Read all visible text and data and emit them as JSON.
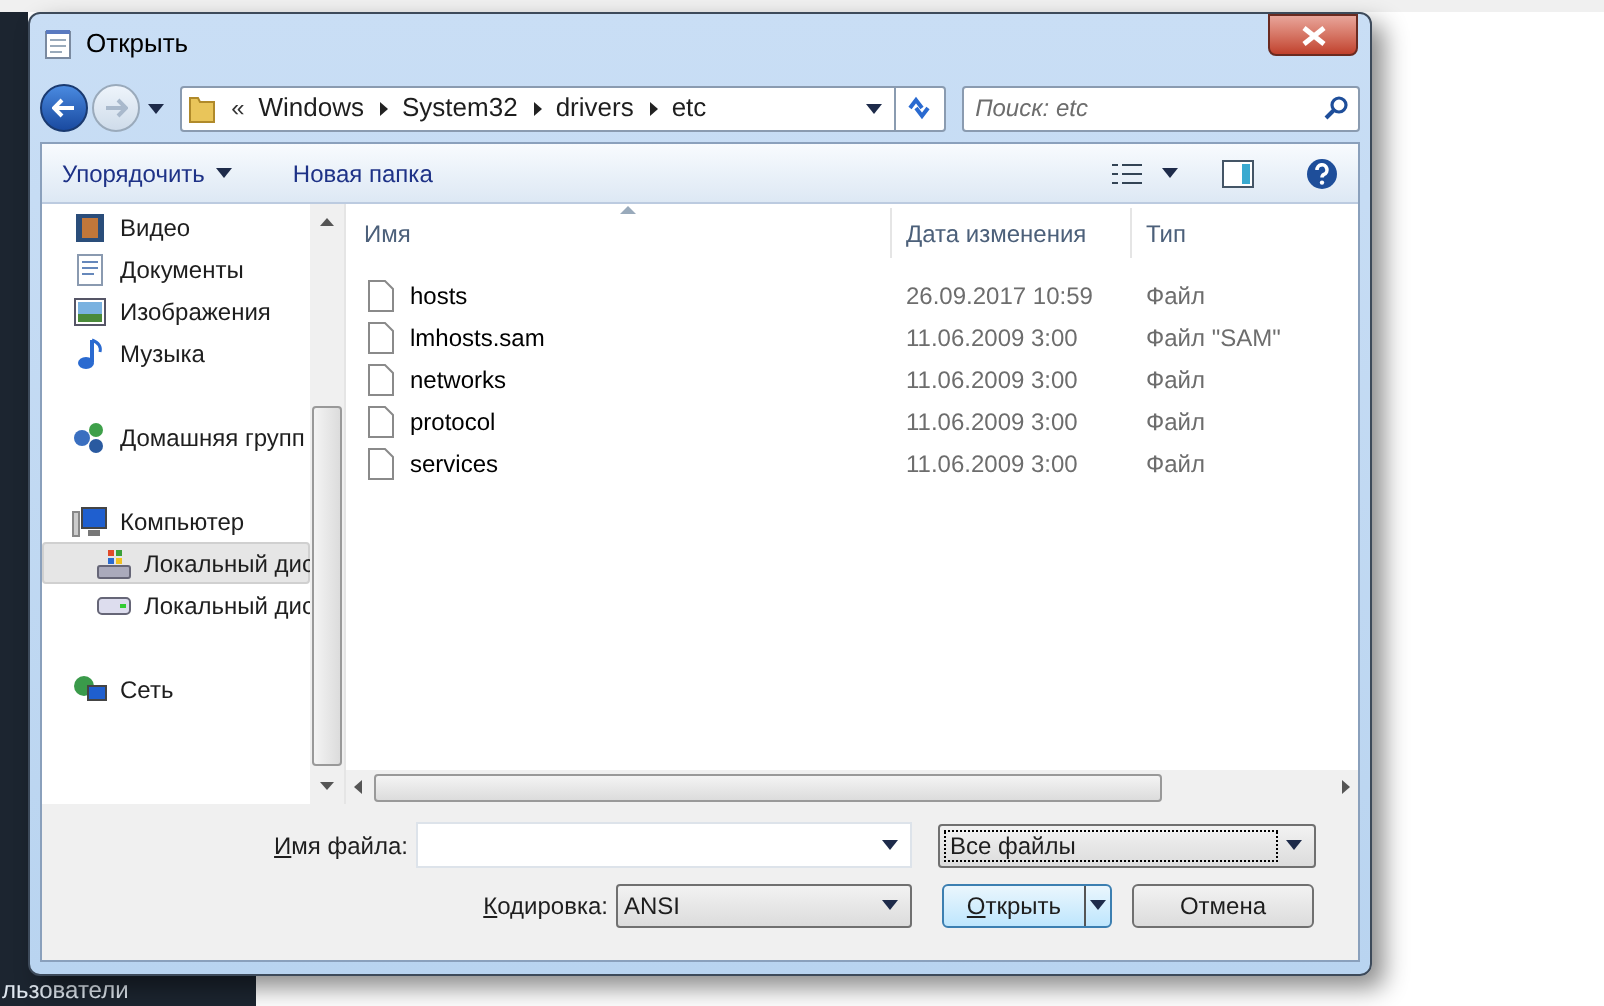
{
  "background": {
    "taskbar_text": "льзователи"
  },
  "dialog": {
    "title": "Открыть",
    "address": {
      "overflow": "«",
      "path": [
        "Windows",
        "System32",
        "drivers",
        "etc"
      ]
    },
    "search": {
      "placeholder": "Поиск: etc"
    },
    "toolbar": {
      "organize": "Упорядочить",
      "new_folder": "Новая папка"
    },
    "sidebar": [
      {
        "items": [
          {
            "kind": "video",
            "label": "Видео",
            "selected": false
          },
          {
            "kind": "documents",
            "label": "Документы",
            "selected": false
          },
          {
            "kind": "images",
            "label": "Изображения",
            "selected": false
          },
          {
            "kind": "music",
            "label": "Музыка",
            "selected": false
          }
        ]
      },
      {
        "items": [
          {
            "kind": "homegroup",
            "label": "Домашняя групп",
            "selected": false
          }
        ]
      },
      {
        "items": [
          {
            "kind": "computer",
            "label": "Компьютер",
            "selected": false,
            "children": [
              {
                "kind": "system-drive",
                "label": "Локальный дис",
                "selected": true
              },
              {
                "kind": "drive",
                "label": "Локальный дис",
                "selected": false
              }
            ]
          }
        ]
      },
      {
        "items": [
          {
            "kind": "network",
            "label": "Сеть",
            "selected": false
          }
        ]
      }
    ],
    "columns": [
      "Имя",
      "Дата изменения",
      "Тип"
    ],
    "files": [
      {
        "name": "hosts",
        "date": "26.09.2017 10:59",
        "type": "Файл"
      },
      {
        "name": "lmhosts.sam",
        "date": "11.06.2009 3:00",
        "type": "Файл \"SAM\""
      },
      {
        "name": "networks",
        "date": "11.06.2009 3:00",
        "type": "Файл"
      },
      {
        "name": "protocol",
        "date": "11.06.2009 3:00",
        "type": "Файл"
      },
      {
        "name": "services",
        "date": "11.06.2009 3:00",
        "type": "Файл"
      }
    ],
    "filename": {
      "label": "Имя файла:"
    },
    "filter": {
      "value": "Все файлы"
    },
    "encoding": {
      "label": "Кодировка:",
      "value": "ANSI"
    },
    "buttons": {
      "open": "Открыть",
      "cancel": "Отмена"
    }
  }
}
